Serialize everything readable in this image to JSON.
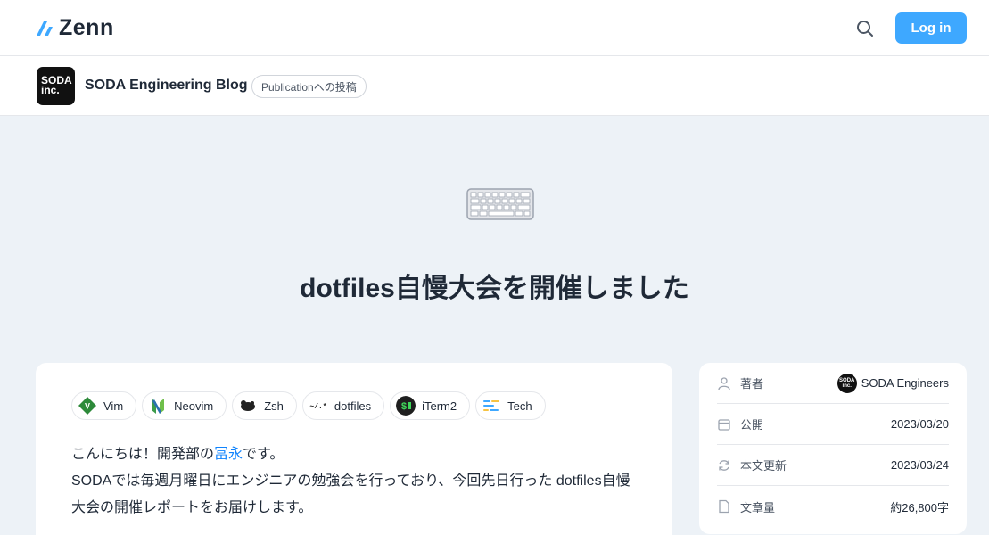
{
  "header": {
    "logo_text": "Zenn",
    "login_label": "Log in",
    "search_icon": "search-icon"
  },
  "publication": {
    "logo_text_line1": "SODA",
    "logo_text_line2": "inc.",
    "name": "SODA Engineering Blog",
    "badge": "Publicationへの投稿"
  },
  "article": {
    "emoji": "keyboard-emoji",
    "title": "dotfiles自慢大会を開催しました",
    "topics": [
      {
        "label": "Vim",
        "icon": "vim-icon"
      },
      {
        "label": "Neovim",
        "icon": "neovim-icon"
      },
      {
        "label": "Zsh",
        "icon": "zsh-icon"
      },
      {
        "label": "dotfiles",
        "icon": "dotfiles-icon"
      },
      {
        "label": "iTerm2",
        "icon": "iterm2-icon"
      },
      {
        "label": "Tech",
        "icon": "tech-icon"
      }
    ],
    "body_line1_prefix": "こんにちは！開発部の",
    "body_line1_link": "冨永",
    "body_line1_suffix": "です。",
    "body_paragraph2": "SODAでは毎週月曜日にエンジニアの勉強会を行っており、今回先日行った dotfiles自慢大会の開催レポートをお届けします。"
  },
  "info": {
    "author_label": "著者",
    "author_name": "SODA Engineers",
    "published_label": "公開",
    "published_date": "2023/03/20",
    "updated_label": "本文更新",
    "updated_date": "2023/03/24",
    "length_label": "文章量",
    "length_value": "約26,800字"
  },
  "colors": {
    "accent": "#3ea8ff",
    "link": "#0f83fd",
    "page_bg": "#edf2f7"
  }
}
